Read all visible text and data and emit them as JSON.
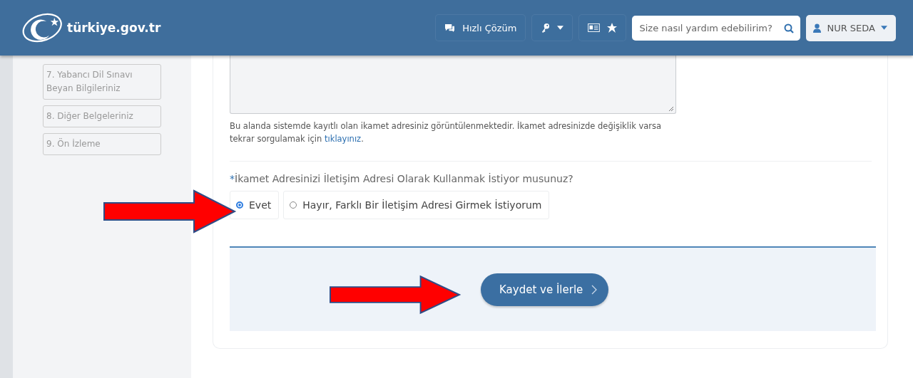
{
  "header": {
    "logo_text": "türkiye.gov.tr",
    "quick_solution": "Hızlı Çözüm",
    "search": {
      "placeholder": "Size nasıl yardım edebilirim?"
    },
    "user": "NUR SEDA"
  },
  "sidebar": {
    "items": [
      {
        "label": "7. Yabancı Dil Sınavı Beyan Bilgileriniz"
      },
      {
        "label": "8. Diğer Belgeleriniz"
      },
      {
        "label": "9. Ön İzleme"
      }
    ]
  },
  "form": {
    "help_text": "Bu alanda sistemde kayıtlı olan ikamet adresiniz görüntülenmektedir. İkamet adresinizde değişiklik varsa tekrar sorgulamak için ",
    "help_link": "tıklayınız",
    "help_end": ".",
    "required_mark": "*",
    "question": "İkamet Adresinizi İletişim Adresi Olarak Kullanmak İstiyor musunuz?",
    "options": [
      {
        "label": "Evet",
        "selected": true
      },
      {
        "label": "Hayır, Farklı Bir İletişim Adresi Girmek İstiyorum",
        "selected": false
      }
    ],
    "save_button": "Kaydet ve İlerle"
  }
}
